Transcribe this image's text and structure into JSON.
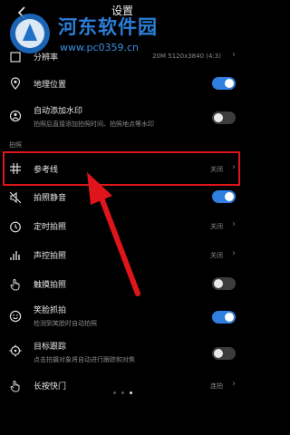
{
  "header": {
    "title": "设置"
  },
  "watermark": {
    "title": "河东软件园",
    "url": "www.pc0359.cn"
  },
  "rows": {
    "resolution": {
      "label": "分辨率",
      "value": "20M 5120x3840 (4:3)"
    },
    "location": {
      "label": "地理位置",
      "toggle": "on"
    },
    "auto_watermark": {
      "label": "自动添加水印",
      "sub": "拍照后直接添加拍照时间、拍照地点等水印",
      "toggle": "off"
    },
    "section_photo": "拍照",
    "grid": {
      "label": "参考线",
      "value": "关闭"
    },
    "mute": {
      "label": "拍照静音",
      "toggle": "on"
    },
    "timer": {
      "label": "定时拍照",
      "value": "关闭"
    },
    "audio": {
      "label": "声控拍照",
      "value": "关闭"
    },
    "touch": {
      "label": "触摸拍照",
      "toggle": "off"
    },
    "smile": {
      "label": "笑脸抓拍",
      "sub": "检测到笑脸时自动拍照",
      "toggle": "on"
    },
    "tracking": {
      "label": "目标跟踪",
      "sub": "点击拍摄对象将自动进行跟踪和对焦",
      "toggle": "off"
    },
    "shutter": {
      "label": "长按快门",
      "value": "连拍"
    }
  },
  "pager": {
    "count": 3,
    "active": 2
  },
  "colors": {
    "accent": "#2e7fe0",
    "highlight": "#e0151b",
    "watermark": "#2b7fd8"
  }
}
